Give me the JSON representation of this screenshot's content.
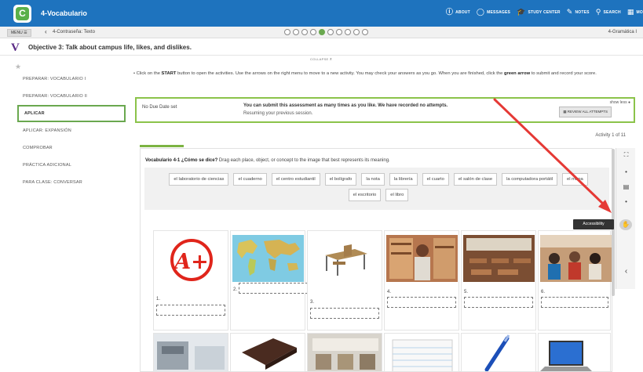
{
  "colors": {
    "topbar": "#1e73be",
    "accent_green": "#6aa84f",
    "arrow_red": "#e53935",
    "objective_purple": "#5b2a86"
  },
  "topbar": {
    "title": "4-Vocabulario",
    "nav": [
      {
        "icon": "about-icon",
        "glyph": "ⓘ",
        "label": "ABOUT"
      },
      {
        "icon": "messages-icon",
        "glyph": "◯",
        "label": "MESSAGES"
      },
      {
        "icon": "study-center-icon",
        "glyph": "🎓",
        "label": "STUDY CENTER"
      },
      {
        "icon": "notes-icon",
        "glyph": "✎",
        "label": "NOTES"
      },
      {
        "icon": "search-icon",
        "glyph": "⚲",
        "label": "SEARCH"
      },
      {
        "icon": "more-icon",
        "glyph": "▦",
        "label": "MO"
      }
    ]
  },
  "subbar": {
    "menu": "MENU ☰",
    "prev": "4-Contraseña: Texto",
    "next": "4-Gramática I",
    "dot_count": 10,
    "active_dot": 4
  },
  "objective": {
    "title": "Objective 3: Talk about campus life, likes, and dislikes.",
    "collapse": "COLLAPSE ⊼"
  },
  "sidebar": {
    "items": [
      {
        "label": "PREPARAR: VOCABULARIO I",
        "active": false
      },
      {
        "label": "PREPARAR: VOCABULARIO II",
        "active": false
      },
      {
        "label": "APLICAR",
        "active": true
      },
      {
        "label": "APLICAR: EXPANSIÓN",
        "active": false
      },
      {
        "label": "COMPROBAR",
        "active": false
      },
      {
        "label": "PRÁCTICA ADICIONAL",
        "active": false
      },
      {
        "label": "PARA CLASE: CONVERSAR",
        "active": false
      }
    ]
  },
  "instructions": {
    "pre": "• Click on the ",
    "start": "START",
    "mid": " button to open the activities. Use the arrows on the right menu to move to a new activity. You may check your answers as you go. When you are finished, click the ",
    "green": "green arrow",
    "post": " to submit and record your score."
  },
  "due": {
    "label": "No Due Date set",
    "message": "You can submit this assessment as many times as you like. We have recorded no attempts.",
    "resume": "Resuming your previous session.",
    "show_less": "show less ●",
    "review": "▦ REVIEW ALL ATTEMPTS"
  },
  "activity": {
    "count": "Activity 1 of 11",
    "title_bold": "Vocabulario 4-1 ¿Cómo se dice?",
    "title_rest": " Drag each place, object, or concept to the image that best represents its meaning.",
    "words": [
      "el laboratorio de ciencias",
      "el cuaderno",
      "el centro estudiantil",
      "el bolígrafo",
      "la nota",
      "la librería",
      "el cuarto",
      "el salón de clase",
      "la computadora portátil",
      "el mapa",
      "el escritorio",
      "el libro"
    ],
    "numbers": [
      "1.",
      "2.",
      "3.",
      "4.",
      "5.",
      "6."
    ],
    "grade_glyph": "A+"
  },
  "tools": {
    "expand": "⛶",
    "dot1": "•",
    "doc": "▤",
    "dot2": "•",
    "collapse_arrow": "‹",
    "accessibility_glyph": "✋",
    "tooltip": "Accessibility"
  }
}
